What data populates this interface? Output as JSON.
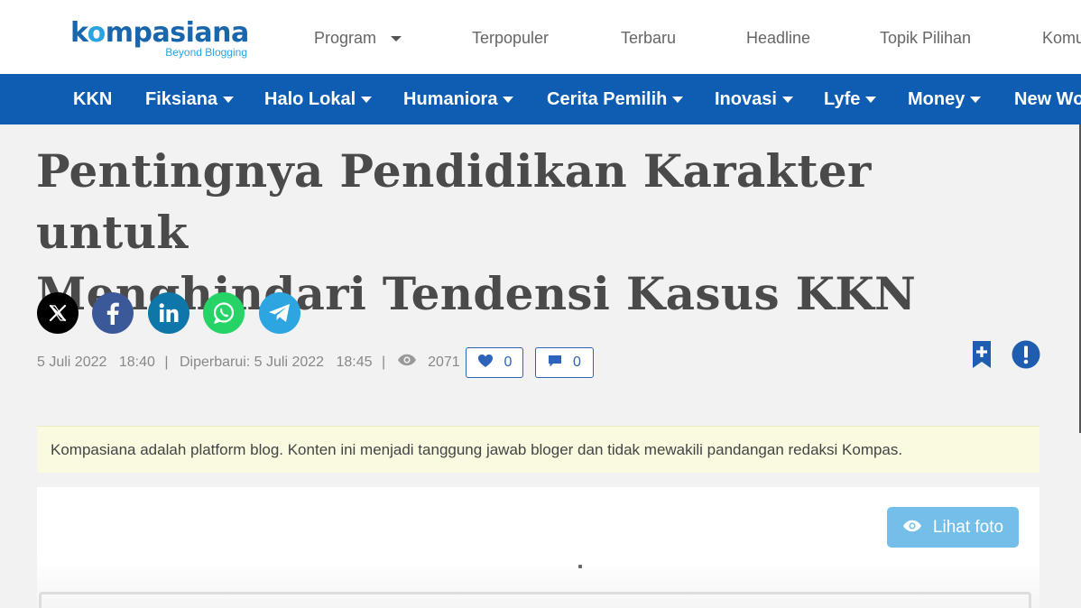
{
  "brand": {
    "logo_prefix": "k",
    "logo_o": "o",
    "logo_suffix": "mpasiana",
    "tagline": "Beyond Blogging"
  },
  "top_nav": [
    {
      "label": "Program",
      "has_dropdown": true
    },
    {
      "label": "Terpopuler"
    },
    {
      "label": "Terbaru"
    },
    {
      "label": "Headline"
    },
    {
      "label": "Topik Pilihan"
    },
    {
      "label": "Komu"
    }
  ],
  "categories": [
    {
      "label": "KKN",
      "has_dropdown": false
    },
    {
      "label": "Fiksiana",
      "has_dropdown": true
    },
    {
      "label": "Halo Lokal",
      "has_dropdown": true
    },
    {
      "label": "Humaniora",
      "has_dropdown": true
    },
    {
      "label": "Cerita Pemilih",
      "has_dropdown": true
    },
    {
      "label": "Inovasi",
      "has_dropdown": true
    },
    {
      "label": "Lyfe",
      "has_dropdown": true
    },
    {
      "label": "Money",
      "has_dropdown": true
    },
    {
      "label": "New Wo",
      "has_dropdown": false
    }
  ],
  "article": {
    "title_line1": "Pentingnya Pendidikan Karakter untuk",
    "title_line2": "Menghindari Tendensi Kasus KKN",
    "date": "5 Juli 2022",
    "time": "18:40",
    "separator": "|",
    "updated": "Diperbarui: 5 Juli 2022",
    "updated_time": "18:45",
    "views": "2071",
    "likes": "0",
    "comments": "0"
  },
  "share": [
    {
      "name": "x-icon",
      "color": "#000000"
    },
    {
      "name": "facebook-icon",
      "color": "#3b5998"
    },
    {
      "name": "linkedin-icon",
      "color": "#0e76a8"
    },
    {
      "name": "whatsapp-icon",
      "color": "#25d366"
    },
    {
      "name": "telegram-icon",
      "color": "#2ca5e0"
    }
  ],
  "notice": "Kompasiana adalah platform blog. Konten ini menjadi tanggung jawab bloger dan tidak mewakili pandangan redaksi Kompas.",
  "photo": {
    "view_button": "Lihat foto"
  },
  "colors": {
    "brand_blue": "#0e5db3",
    "accent_blue": "#2d63b8",
    "notice_bg": "#fafae0"
  }
}
